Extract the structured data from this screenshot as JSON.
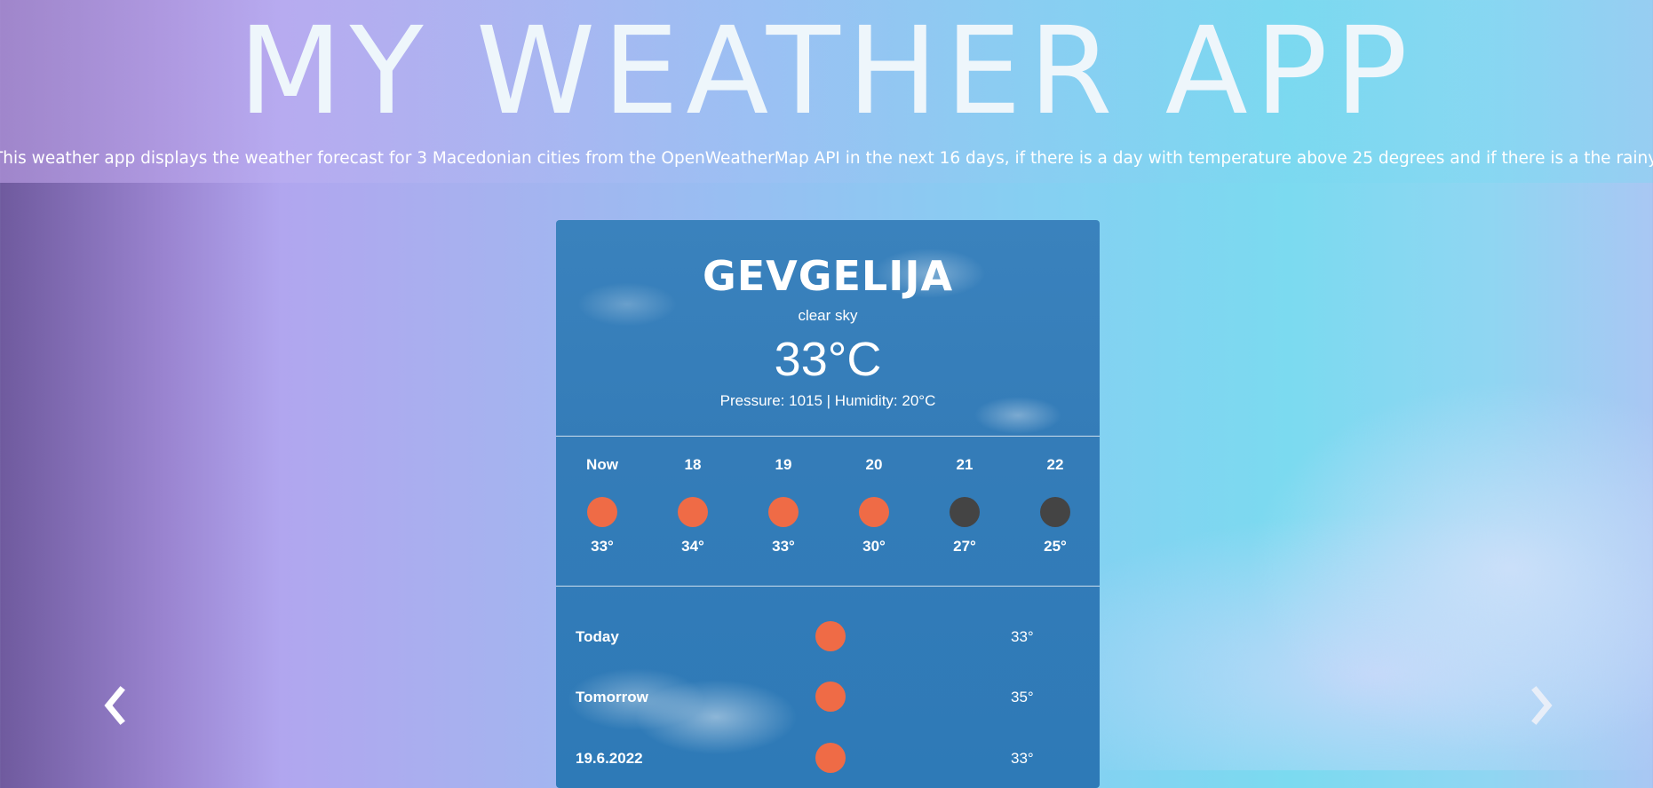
{
  "header": {
    "title": "MY WEATHER APP",
    "description": "This weather app displays the weather forecast for 3 Macedonian cities from the OpenWeatherMap API in the next 16 days, if there is a day with temperature above 25 degrees and if there is a the rainy day"
  },
  "card": {
    "city": "GEVGELIJA",
    "condition": "clear sky",
    "temperature": "33°C",
    "details": "Pressure: 1015  |  Humidity: 20°C",
    "hourly": [
      {
        "label": "Now",
        "temp": "33°",
        "icon": "sun-icon",
        "color": "#ef6b46"
      },
      {
        "label": "18",
        "temp": "34°",
        "icon": "sun-icon",
        "color": "#ef6b46"
      },
      {
        "label": "19",
        "temp": "33°",
        "icon": "sun-icon",
        "color": "#ef6b46"
      },
      {
        "label": "20",
        "temp": "30°",
        "icon": "sun-icon",
        "color": "#ef6b46"
      },
      {
        "label": "21",
        "temp": "27°",
        "icon": "moon-icon",
        "color": "#444444"
      },
      {
        "label": "22",
        "temp": "25°",
        "icon": "moon-icon",
        "color": "#444444"
      }
    ],
    "daily": [
      {
        "day": "Today",
        "temp": "33°",
        "icon": "sun-icon"
      },
      {
        "day": "Tomorrow",
        "temp": "35°",
        "icon": "sun-icon"
      },
      {
        "day": "19.6.2022",
        "temp": "33°",
        "icon": "sun-icon"
      }
    ]
  },
  "carousel": {
    "prev_icon": "chevron-left-icon",
    "next_icon": "chevron-right-icon"
  },
  "colors": {
    "sun": "#ef6b46",
    "night": "#444444",
    "card_blue": "#2e7ab7"
  }
}
